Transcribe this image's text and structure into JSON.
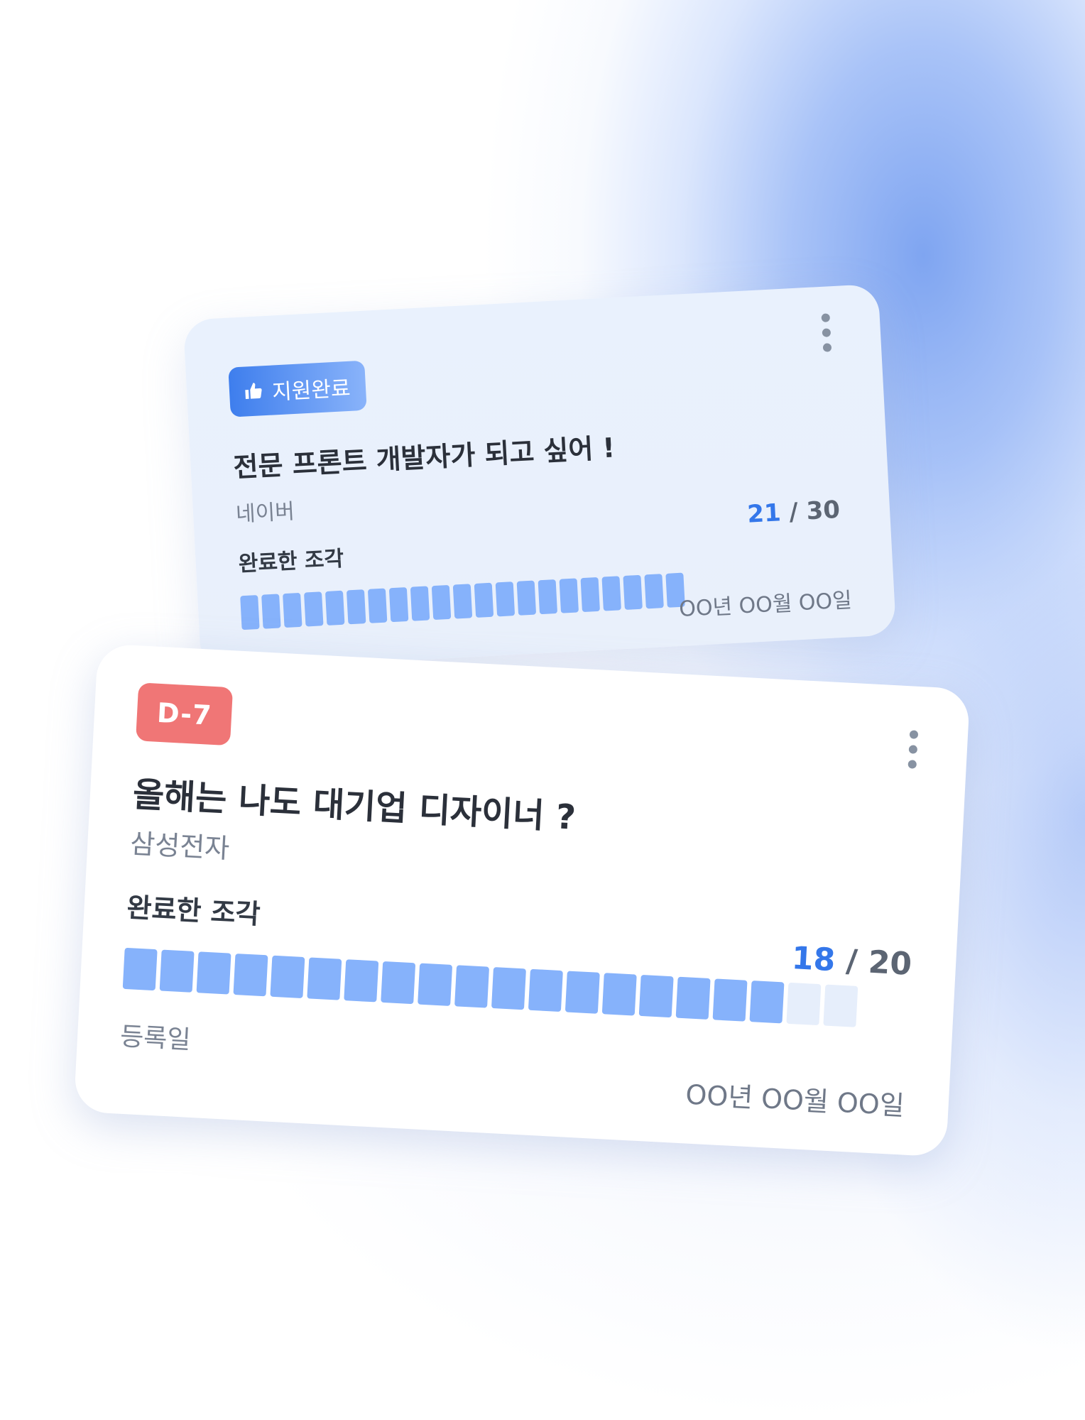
{
  "colors": {
    "accent": "#3477ea",
    "piece_filled": "#86b2fb",
    "piece_empty": "#e6eefb",
    "dday": "#f07676"
  },
  "cards": [
    {
      "badge": "지원완료",
      "badge_icon": "thumbs-up-icon",
      "title": "전문 프론트 개발자가 되고 싶어 !",
      "company": "네이버",
      "progress_label": "완료한 조각",
      "completed": "21",
      "total": "30",
      "pieces_shown": 21,
      "pieces_filled": 21,
      "date": "OO년 OO월 OO일"
    },
    {
      "badge": "D-7",
      "title": "올해는 나도 대기업 디자이너 ?",
      "company": "삼성전자",
      "progress_label": "완료한 조각",
      "completed": "18",
      "total": "20",
      "pieces_shown": 20,
      "pieces_filled": 18,
      "registered_label": "등록일",
      "date": "OO년 OO월 OO일"
    }
  ]
}
